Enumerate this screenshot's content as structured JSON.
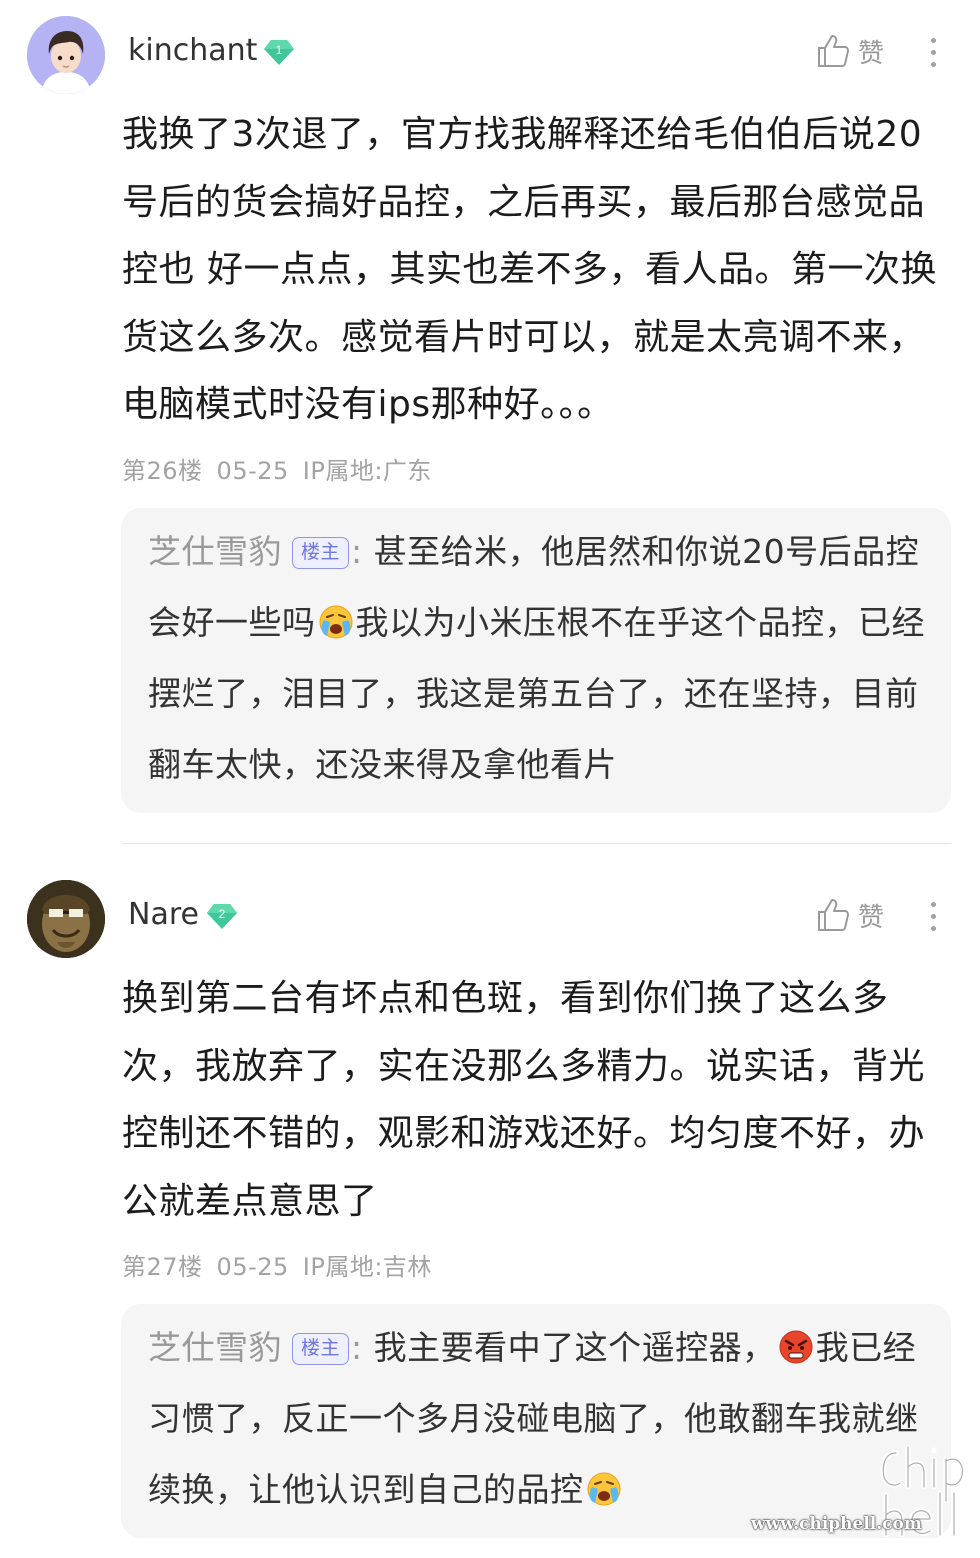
{
  "comments": [
    {
      "username": "kinchant",
      "level": "1",
      "like_label": "赞",
      "text": "我换了3次退了，官方找我解释还给毛伯伯后说20号后的货会搞好品控，之后再买，最后那台感觉品控也 好一点点，其实也差不多，看人品。第一次换货这么多次。感觉看片时可以，就是太亮调不来，电脑模式时没有ips那种好。。。",
      "floor": "第26楼",
      "date": "05-25",
      "ip": "IP属地:广东",
      "reply": {
        "author": "芝仕雪豹",
        "tag": "楼主",
        "colon": ":",
        "text_before": " 甚至给米，他居然和你说20号后品控会好一些吗",
        "emoji": "crying-face-icon",
        "text_after": "我以为小米压根不在乎这个品控，已经摆烂了，泪目了，我这是第五台了，还在坚持，目前翻车太快，还没来得及拿他看片"
      }
    },
    {
      "username": "Nare",
      "level": "2",
      "like_label": "赞",
      "text": "换到第二台有坏点和色斑，看到你们换了这么多次，我放弃了，实在没那么多精力。说实话，背光控制还不错的，观影和游戏还好。均匀度不好，办公就差点意思了",
      "floor": "第27楼",
      "date": "05-25",
      "ip": "IP属地:吉林",
      "reply": {
        "author": "芝仕雪豹",
        "tag": "楼主",
        "colon": ":",
        "text_before": " 我主要看中了这个遥控器，",
        "emoji": "angry-face-icon",
        "text_after": "我已经习惯了，反正一个多月没碰电脑了，他敢翻车我就继续换，让他认识到自己的品控",
        "emoji_end": "crying-face-icon"
      }
    }
  ],
  "watermark": {
    "url": "www.chiphell.com",
    "logo_text": "chip hell"
  },
  "colors": {
    "level_badge": "#3fc79a",
    "op_tag": "#6f76de",
    "reply_bg": "#f5f5f6",
    "meta_text": "#a3a3a3"
  }
}
